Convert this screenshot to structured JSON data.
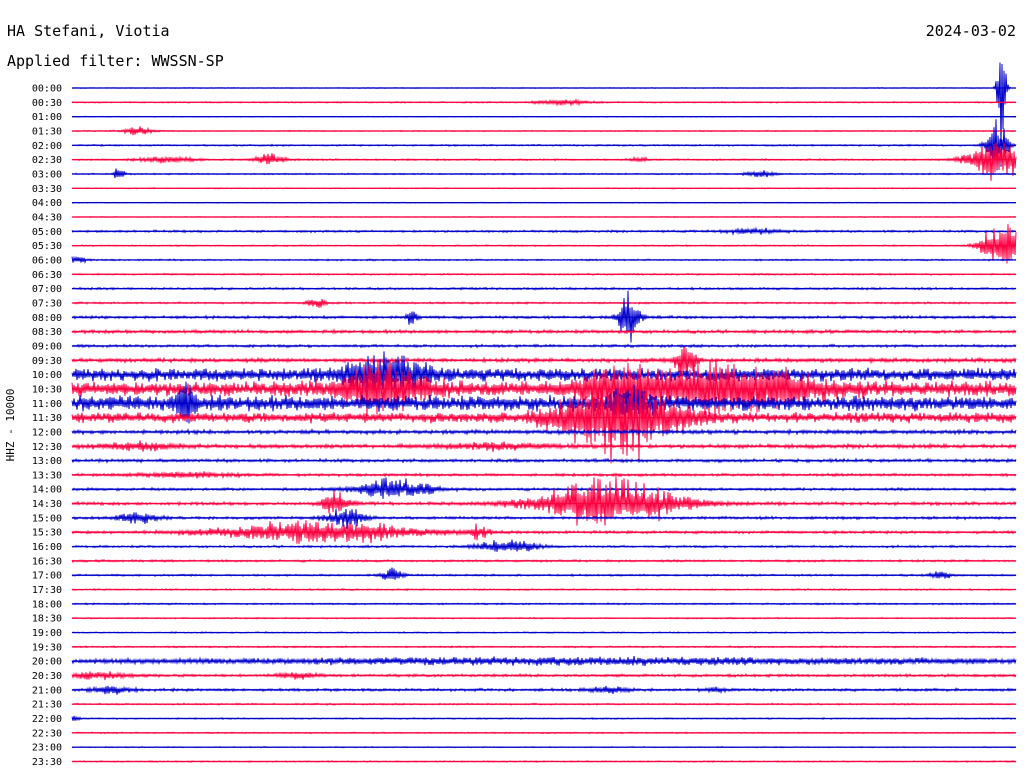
{
  "header": {
    "station": "HA Stefani, Viotia",
    "date": "2024-03-02",
    "filter": "Applied filter: WWSSN-SP",
    "channel_label": "HHZ - 10000"
  },
  "colors": {
    "even_row": "#0000cc",
    "odd_row": "#ff0040",
    "background": "#ffffff"
  },
  "chart_data": {
    "type": "line",
    "title": "HA Stefani, Viotia",
    "date": "2024-03-02",
    "filter": "WWSSN-SP",
    "ylabel": "HHZ - 10000",
    "rows": [
      "00:00",
      "00:30",
      "01:00",
      "01:30",
      "02:00",
      "02:30",
      "03:00",
      "03:30",
      "04:00",
      "04:30",
      "05:00",
      "05:30",
      "06:00",
      "06:30",
      "07:00",
      "07:30",
      "08:00",
      "08:30",
      "09:00",
      "09:30",
      "10:00",
      "10:30",
      "11:00",
      "11:30",
      "12:00",
      "12:30",
      "13:00",
      "13:30",
      "14:00",
      "14:30",
      "15:00",
      "15:30",
      "16:00",
      "16:30",
      "17:00",
      "17:30",
      "18:00",
      "18:30",
      "19:00",
      "19:30",
      "20:00",
      "20:30",
      "21:00",
      "21:30",
      "22:00",
      "22:30",
      "23:00",
      "23:30"
    ],
    "row_minutes": 30,
    "noise_level": [
      0.3,
      0.5,
      0.3,
      0.4,
      0.6,
      0.6,
      0.5,
      0.4,
      0.3,
      0.3,
      0.8,
      0.5,
      0.6,
      0.6,
      0.8,
      0.7,
      1.0,
      1.2,
      1.0,
      1.5,
      5.0,
      6.0,
      6.0,
      4.0,
      1.5,
      1.5,
      1.2,
      1.0,
      1.0,
      1.2,
      1.0,
      1.0,
      0.8,
      0.8,
      0.7,
      0.6,
      0.6,
      0.5,
      0.5,
      0.6,
      1.2,
      1.0,
      1.0,
      0.6,
      0.5,
      0.5,
      0.4,
      0.5
    ],
    "events": [
      {
        "row": 1,
        "t": 0.52,
        "amp": 3,
        "dur": 0.03
      },
      {
        "row": 3,
        "t": 0.07,
        "amp": 5,
        "dur": 0.015
      },
      {
        "row": 5,
        "t": 0.1,
        "amp": 4,
        "dur": 0.03
      },
      {
        "row": 5,
        "t": 0.21,
        "amp": 7,
        "dur": 0.015
      },
      {
        "row": 5,
        "t": 0.6,
        "amp": 3,
        "dur": 0.01
      },
      {
        "row": 6,
        "t": 0.05,
        "amp": 9,
        "dur": 0.005
      },
      {
        "row": 6,
        "t": 0.73,
        "amp": 4,
        "dur": 0.015
      },
      {
        "row": 10,
        "t": 0.72,
        "amp": 3,
        "dur": 0.03
      },
      {
        "row": 12,
        "t": 0.005,
        "amp": 4,
        "dur": 0.01
      },
      {
        "row": 15,
        "t": 0.26,
        "amp": 6,
        "dur": 0.01
      },
      {
        "row": 16,
        "t": 0.36,
        "amp": 15,
        "dur": 0.005
      },
      {
        "row": 16,
        "t": 0.59,
        "amp": 40,
        "dur": 0.01
      },
      {
        "row": 19,
        "t": 0.65,
        "amp": 25,
        "dur": 0.01
      },
      {
        "row": 20,
        "t": 0.33,
        "amp": 25,
        "dur": 0.04
      },
      {
        "row": 21,
        "t": 0.33,
        "amp": 30,
        "dur": 0.04
      },
      {
        "row": 21,
        "t": 0.58,
        "amp": 25,
        "dur": 0.04
      },
      {
        "row": 21,
        "t": 0.7,
        "amp": 30,
        "dur": 0.08
      },
      {
        "row": 22,
        "t": 0.12,
        "amp": 25,
        "dur": 0.01
      },
      {
        "row": 22,
        "t": 0.59,
        "amp": 22,
        "dur": 0.02
      },
      {
        "row": 23,
        "t": 0.58,
        "amp": 50,
        "dur": 0.06
      },
      {
        "row": 25,
        "t": 0.07,
        "amp": 5,
        "dur": 0.04
      },
      {
        "row": 25,
        "t": 0.45,
        "amp": 4,
        "dur": 0.05
      },
      {
        "row": 27,
        "t": 0.12,
        "amp": 3,
        "dur": 0.05
      },
      {
        "row": 28,
        "t": 0.34,
        "amp": 12,
        "dur": 0.04
      },
      {
        "row": 29,
        "t": 0.28,
        "amp": 14,
        "dur": 0.015
      },
      {
        "row": 29,
        "t": 0.57,
        "amp": 30,
        "dur": 0.07
      },
      {
        "row": 30,
        "t": 0.07,
        "amp": 7,
        "dur": 0.02
      },
      {
        "row": 30,
        "t": 0.29,
        "amp": 12,
        "dur": 0.02
      },
      {
        "row": 31,
        "t": 0.26,
        "amp": 14,
        "dur": 0.1
      },
      {
        "row": 31,
        "t": 0.43,
        "amp": 10,
        "dur": 0.01
      },
      {
        "row": 32,
        "t": 0.46,
        "amp": 9,
        "dur": 0.03
      },
      {
        "row": 34,
        "t": 0.34,
        "amp": 10,
        "dur": 0.01
      },
      {
        "row": 34,
        "t": 0.92,
        "amp": 6,
        "dur": 0.01
      },
      {
        "row": 40,
        "t": 0.56,
        "amp": 4,
        "dur": 0.45
      },
      {
        "row": 41,
        "t": 0.02,
        "amp": 4,
        "dur": 0.04
      },
      {
        "row": 41,
        "t": 0.24,
        "amp": 4,
        "dur": 0.02
      },
      {
        "row": 42,
        "t": 0.04,
        "amp": 5,
        "dur": 0.02
      },
      {
        "row": 42,
        "t": 0.57,
        "amp": 4,
        "dur": 0.02
      },
      {
        "row": 42,
        "t": 0.68,
        "amp": 4,
        "dur": 0.01
      },
      {
        "row": 44,
        "t": 0.003,
        "amp": 3,
        "dur": 0.005
      },
      {
        "row": 0,
        "t": 0.985,
        "amp": 85,
        "dur": 0.004
      },
      {
        "row": 4,
        "t": 0.98,
        "amp": 35,
        "dur": 0.01
      },
      {
        "row": 5,
        "t": 0.98,
        "amp": 25,
        "dur": 0.03
      },
      {
        "row": 11,
        "t": 0.985,
        "amp": 30,
        "dur": 0.02
      }
    ]
  }
}
